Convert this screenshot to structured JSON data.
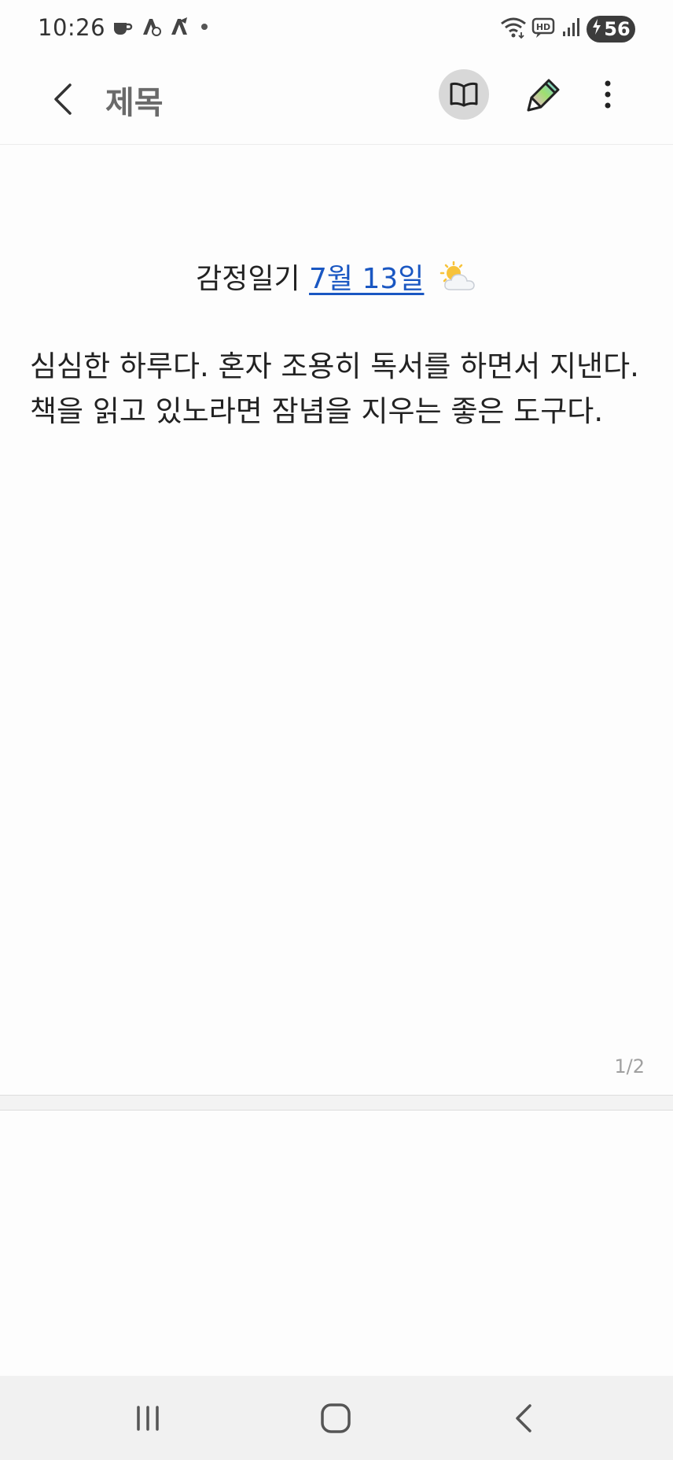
{
  "status_bar": {
    "time": "10:26",
    "left_icons": [
      "coffee-icon",
      "app-notification-icon",
      "app-notification-icon",
      "dot-icon"
    ],
    "right_icons": [
      "wifi-icon",
      "hd-voice-icon",
      "signal-icon"
    ],
    "battery_level": "56"
  },
  "app_bar": {
    "title": "제목",
    "actions": [
      "reader-mode-icon",
      "pen-icon",
      "more-options-icon"
    ]
  },
  "note": {
    "headline_prefix": "감정일기",
    "headline_date": "7월 13일",
    "weather_icon": "sun-behind-cloud-icon",
    "body": "심심한 하루다.  혼자 조용히 독서를 하면서 지낸다. 책을 읽고 있노라면  잠념을 지우는 좋은 도구다.",
    "page_counter": "1/2"
  },
  "nav_bar": {
    "buttons": [
      "recent-apps-icon",
      "home-icon",
      "back-icon"
    ]
  },
  "colors": {
    "link": "#1a57c2",
    "title": "#6a6a6a",
    "reader_button_bg": "#d8d8d8"
  }
}
